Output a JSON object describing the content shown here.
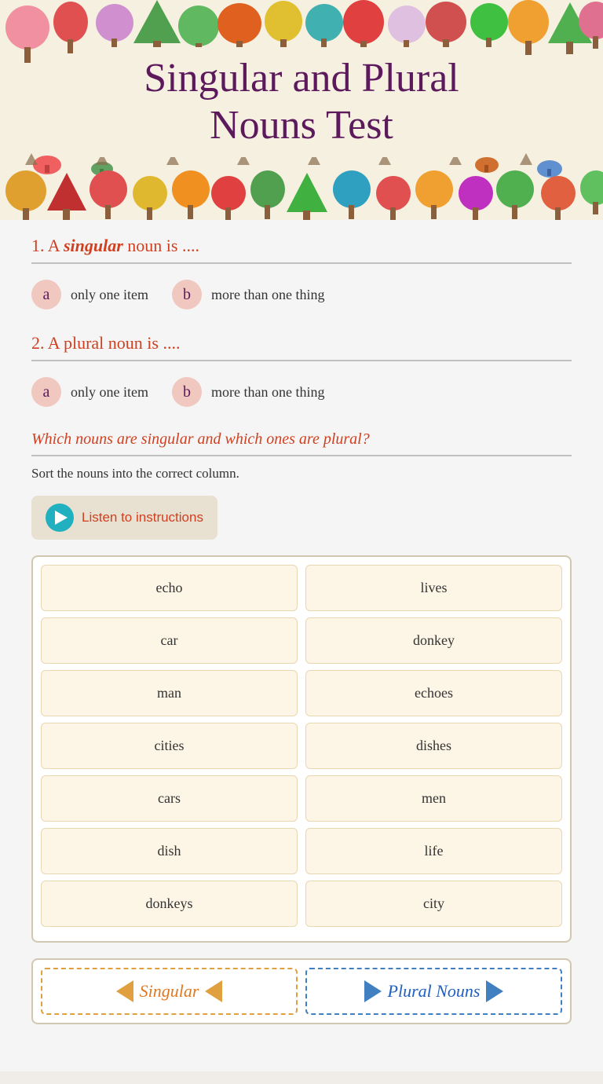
{
  "header": {
    "title_line1": "Singular and Plural",
    "title_line2": "Nouns Test"
  },
  "questions": [
    {
      "id": 1,
      "text_prefix": "1. A ",
      "text_highlight": "singular",
      "text_suffix": " noun is ....",
      "options": [
        {
          "badge": "a",
          "text": "only one item"
        },
        {
          "badge": "b",
          "text": "more than one thing"
        }
      ]
    },
    {
      "id": 2,
      "text_prefix": "2. A plural noun is ....",
      "options": [
        {
          "badge": "a",
          "text": "only one item"
        },
        {
          "badge": "b",
          "text": "more than one thing"
        }
      ]
    }
  ],
  "sort_section": {
    "heading": "Which nouns are singular and which ones are plural?",
    "instruction": "Sort the nouns into the correct column.",
    "listen_button": "Listen to instructions",
    "words": [
      [
        "echo",
        "lives"
      ],
      [
        "car",
        "donkey"
      ],
      [
        "man",
        "echoes"
      ],
      [
        "cities",
        "dishes"
      ],
      [
        "cars",
        "men"
      ],
      [
        "dish",
        "life"
      ],
      [
        "donkeys",
        "city"
      ]
    ],
    "columns": [
      {
        "label": "Singular",
        "type": "singular"
      },
      {
        "label": "Plural Nouns",
        "type": "plural"
      }
    ]
  }
}
